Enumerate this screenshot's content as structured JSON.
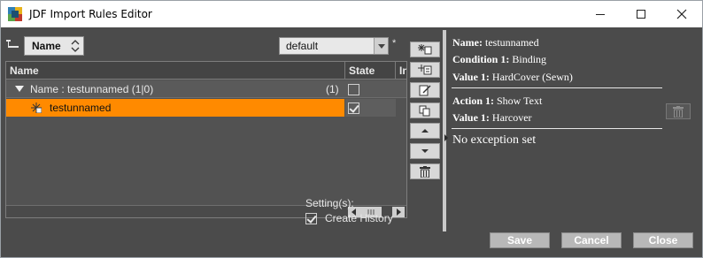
{
  "window": {
    "title": "JDF Import Rules Editor",
    "controls": {
      "minimize": "minimize-icon",
      "maximize": "maximize-icon",
      "close": "close-icon"
    }
  },
  "toolbar": {
    "sort_field": "Name",
    "profile": "default",
    "profile_modified_marker": "*"
  },
  "table": {
    "columns": [
      "Name",
      "State",
      "In"
    ],
    "group": {
      "label": "Name : testunnamed (1|0)",
      "count": "(1)",
      "state_checked": false
    },
    "rows": [
      {
        "name": "testunnamed",
        "state_checked": true,
        "selected": true
      }
    ]
  },
  "settings": {
    "label": "Setting(s):",
    "create_history_label": "Create History",
    "create_history_checked": true
  },
  "details": {
    "condition": [
      {
        "key": "Name:",
        "value": "testunnamed"
      },
      {
        "key": "Condition 1:",
        "value": "Binding"
      },
      {
        "key": "Value 1:",
        "value": "HardCover (Sewn)"
      }
    ],
    "action": [
      {
        "key": "Action 1:",
        "value": "Show Text"
      },
      {
        "key": "Value 1:",
        "value": "Harcover"
      }
    ],
    "exception": "No exception set"
  },
  "buttons": {
    "save": "Save",
    "cancel": "Cancel",
    "close": "Close"
  },
  "colors": {
    "selection": "#ff8a00",
    "background": "#4b4b4b",
    "button": "#b8b8b8"
  }
}
